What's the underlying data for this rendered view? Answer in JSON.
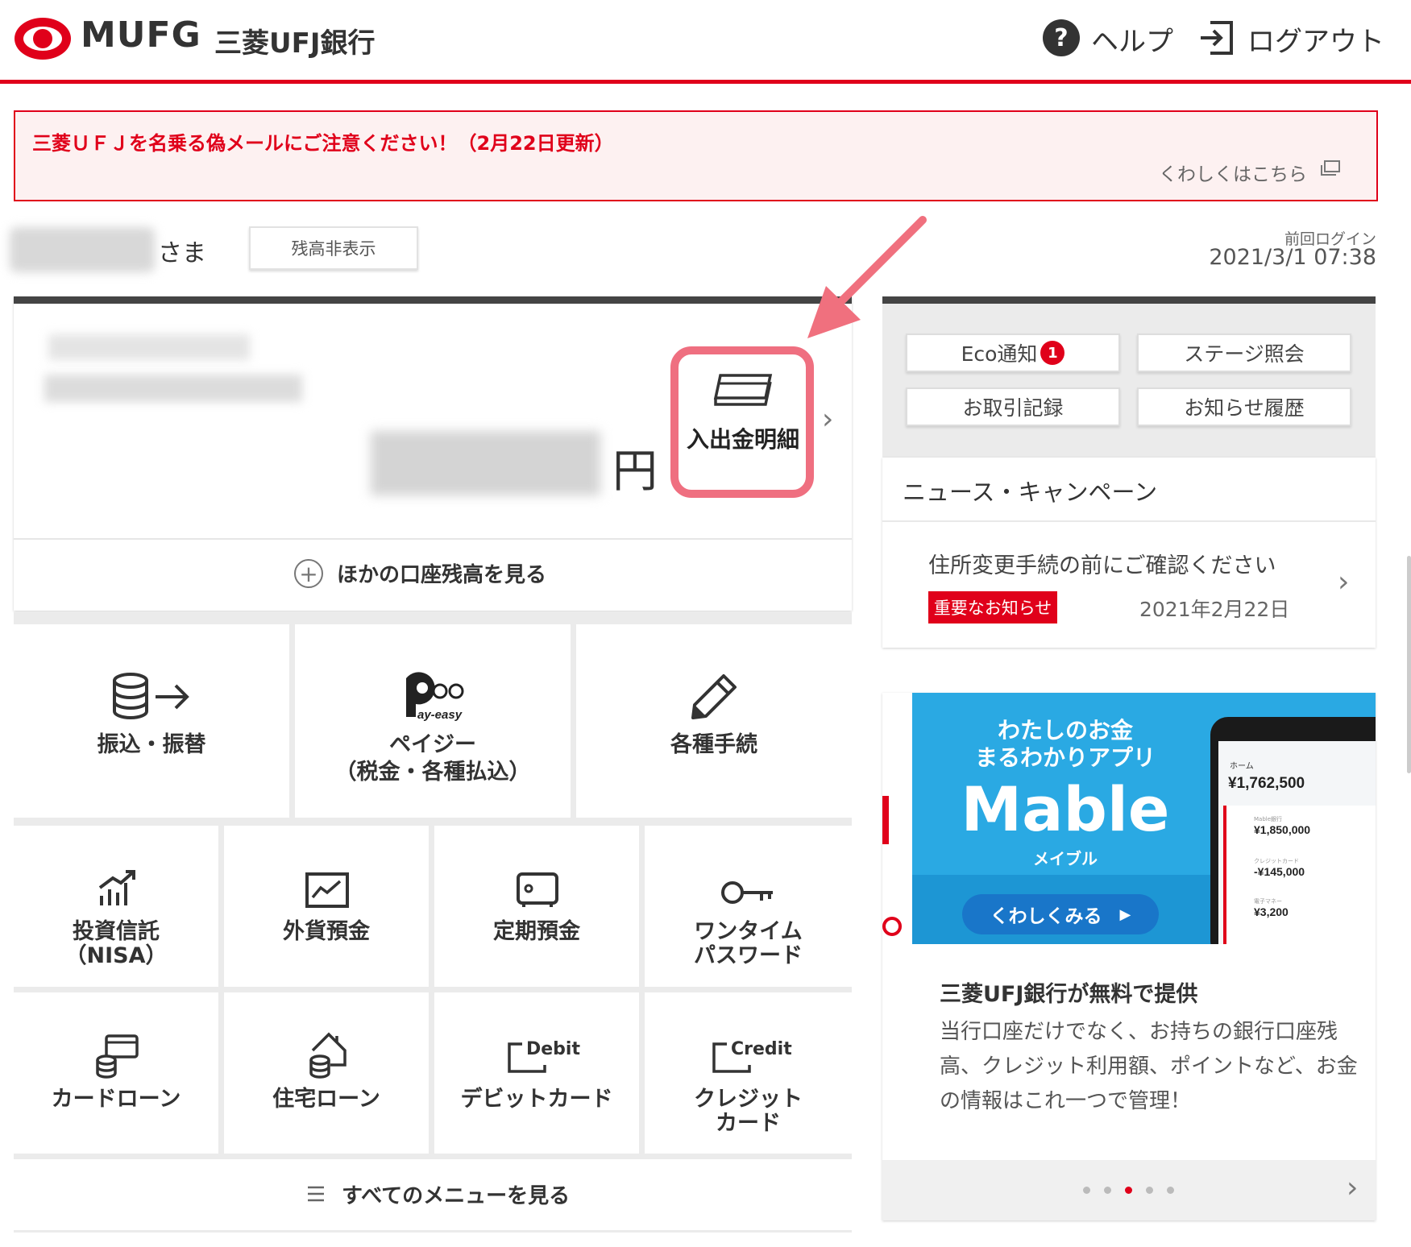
{
  "header": {
    "logo_text": "MUFG",
    "bank_name": "三菱UFJ銀行",
    "help_label": "ヘルプ",
    "logout_label": "ログアウト"
  },
  "alert": {
    "title": "三菱ＵＦＪを名乗る偽メールにご注意ください！（2月22日更新）",
    "link": "くわしくはこちら"
  },
  "user": {
    "honorific": "さま",
    "hide_balance_label": "残高非表示",
    "last_login_label": "前回ログイン",
    "last_login_time": "2021/3/1 07:38"
  },
  "account": {
    "currency": "円",
    "statement_label": "入出金明細",
    "other_balance_label": "ほかの口座残高を見る"
  },
  "menu": {
    "transfer": "振込・振替",
    "payeasy_line1": "ペイジー",
    "payeasy_line2": "（税金・各種払込）",
    "payeasy_logo": "Pay-easy",
    "procedures": "各種手続",
    "investment_line1": "投資信託",
    "investment_line2": "（NISA）",
    "foreign_deposit": "外貨預金",
    "time_deposit": "定期預金",
    "onetime_line1": "ワンタイム",
    "onetime_line2": "パスワード",
    "card_loan": "カードローン",
    "home_loan": "住宅ローン",
    "debit_icon_text": "Debit",
    "debit_card": "デビットカード",
    "credit_icon_text": "Credit",
    "credit_line1": "クレジット",
    "credit_line2": "カード",
    "all_menu": "すべてのメニューを見る"
  },
  "quick": {
    "eco": "Eco通知",
    "eco_badge": "1",
    "stage": "ステージ照会",
    "transactions": "お取引記録",
    "notices": "お知らせ履歴"
  },
  "news": {
    "heading": "ニュース・キャンペーン",
    "title": "住所変更手続の前にご確認ください",
    "badge": "重要なお知らせ",
    "date": "2021年2月22日"
  },
  "promo": {
    "banner_line1": "わたしのお金",
    "banner_line2": "まるわかりアプリ",
    "brand": "Mable",
    "brand_kana": "メイブル",
    "cta": "くわしくみる",
    "phone_home": "ホーム",
    "phone_total": "¥1,762,500",
    "phone_row1_label": "Mable銀行",
    "phone_row1": "¥1,850,000",
    "phone_row2_label": "クレジットカード",
    "phone_row2": "-¥145,000",
    "phone_row3_label": "電子マネー",
    "phone_row3": "¥3,200",
    "title": "三菱UFJ銀行が無料で提供",
    "body": "当行口座だけでなく、お持ちの銀行口座残高、クレジット利用額、ポイントなど、お金の情報はこれ一つで管理！",
    "active_slide": 3,
    "slide_count": 5
  },
  "colors": {
    "brand_red": "#e0001a",
    "highlight_pink": "#ef6f80",
    "banner_blue": "#2aa9e3",
    "cta_blue": "#1976c9"
  }
}
